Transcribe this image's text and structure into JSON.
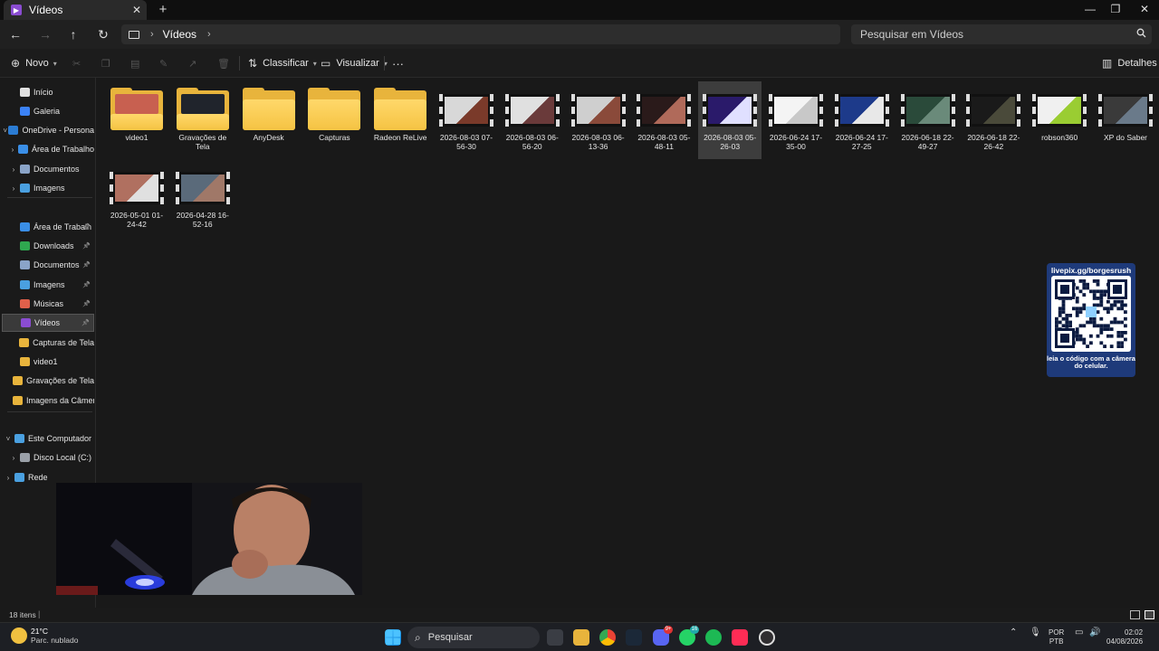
{
  "window": {
    "tab_label": "Vídeos",
    "tab_close": "✕",
    "new_tab": "+",
    "min": "—",
    "restore": "❐",
    "close": "✕"
  },
  "nav": {
    "back": "←",
    "forward": "→",
    "up": "↑",
    "refresh": "↻",
    "breadcrumb": "Vídeos",
    "chevron": "›",
    "search_placeholder": "Pesquisar em Vídeos"
  },
  "toolbar": {
    "new_label": "Novo",
    "sort_label": "Classificar",
    "view_label": "Visualizar",
    "more": "···",
    "details_label": "Detalhes"
  },
  "sidebar": {
    "items": [
      {
        "label": "Início",
        "icon": "home-icon",
        "color": "#e0e0e0"
      },
      {
        "label": "Galeria",
        "icon": "gallery-icon",
        "color": "#3b82f6"
      },
      {
        "label": "OneDrive - Persona",
        "icon": "onedrive-icon",
        "color": "#2b7cd3"
      },
      {
        "label": "Área de Trabalho",
        "icon": "desktop-icon",
        "color": "#3a8ee6"
      },
      {
        "label": "Documentos",
        "icon": "documents-icon",
        "color": "#8aa4c8"
      },
      {
        "label": "Imagens",
        "icon": "images-icon",
        "color": "#4aa0e0"
      },
      {
        "label": "Área de Trabalh",
        "icon": "desktop-icon",
        "color": "#3a8ee6"
      },
      {
        "label": "Downloads",
        "icon": "downloads-icon",
        "color": "#2fa84f"
      },
      {
        "label": "Documentos",
        "icon": "documents-icon",
        "color": "#8aa4c8"
      },
      {
        "label": "Imagens",
        "icon": "images-icon",
        "color": "#4aa0e0"
      },
      {
        "label": "Músicas",
        "icon": "music-icon",
        "color": "#e0604a"
      },
      {
        "label": "Vídeos",
        "icon": "videos-icon",
        "color": "#8a4cd1"
      },
      {
        "label": "Capturas de Tela",
        "icon": "folder-icon",
        "color": "#e8b43c"
      },
      {
        "label": "video1",
        "icon": "folder-icon",
        "color": "#e8b43c"
      },
      {
        "label": "Gravações de Tela",
        "icon": "folder-icon",
        "color": "#e8b43c"
      },
      {
        "label": "Imagens da Câmera",
        "icon": "folder-icon",
        "color": "#e8b43c"
      },
      {
        "label": "Este Computador",
        "icon": "computer-icon",
        "color": "#4aa0e0"
      },
      {
        "label": "Disco Local (C:)",
        "icon": "disk-icon",
        "color": "#9aa0a8"
      },
      {
        "label": "Rede",
        "icon": "network-icon",
        "color": "#4aa0e0"
      }
    ]
  },
  "files": [
    {
      "name": "video1",
      "type": "folder"
    },
    {
      "name": "Gravações de Tela",
      "type": "folder"
    },
    {
      "name": "AnyDesk",
      "type": "folder"
    },
    {
      "name": "Capturas",
      "type": "folder"
    },
    {
      "name": "Radeon ReLive",
      "type": "folder"
    },
    {
      "name": "2026-08-03 07-56-30",
      "type": "video"
    },
    {
      "name": "2026-08-03 06-56-20",
      "type": "video"
    },
    {
      "name": "2026-08-03 06-13-36",
      "type": "video"
    },
    {
      "name": "2026-08-03 05-48-11",
      "type": "video"
    },
    {
      "name": "2026-08-03 05-26-03",
      "type": "video"
    },
    {
      "name": "2026-06-24 17-35-00",
      "type": "video"
    },
    {
      "name": "2026-06-24 17-27-25",
      "type": "video"
    },
    {
      "name": "2026-06-18 22-49-27",
      "type": "video"
    },
    {
      "name": "2026-06-18 22-26-42",
      "type": "video"
    },
    {
      "name": "robson360",
      "type": "video"
    },
    {
      "name": "XP do Saber",
      "type": "video"
    },
    {
      "name": "2026-05-01 01-24-42",
      "type": "video"
    },
    {
      "name": "2026-04-28 16-52-16",
      "type": "video"
    }
  ],
  "overlay": {
    "qr_top": "livepix.gg/borgesrush",
    "qr_bottom": "leia o código com a câmera do celular."
  },
  "status": {
    "count": "18 itens"
  },
  "taskbar": {
    "temp": "21°C",
    "weather": "Parc. nublado",
    "search_label": "Pesquisar",
    "lang1": "POR",
    "lang2": "PTB",
    "time": "02:02",
    "date": "04/08/2026",
    "whatsapp_badge": "16",
    "discord_badge": "9+"
  }
}
